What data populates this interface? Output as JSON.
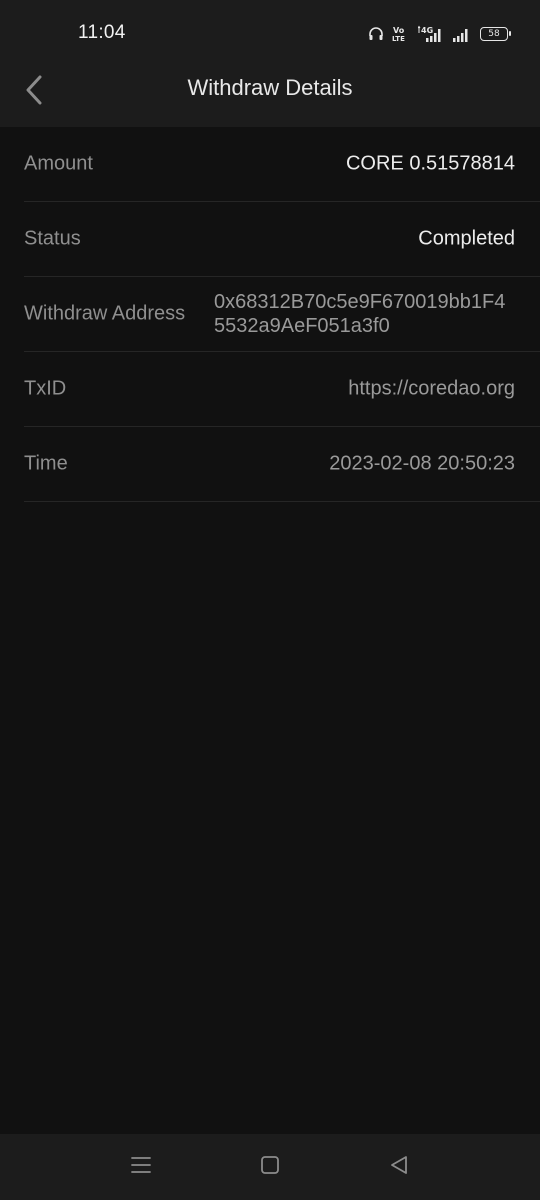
{
  "status_bar": {
    "time": "11:04",
    "network_label": "4G",
    "volte_label": "Vo LTE",
    "battery_level": "58",
    "icons": [
      "headphones-icon",
      "volte-icon",
      "signal-4g-icon",
      "signal-bars-icon",
      "battery-icon"
    ]
  },
  "header": {
    "title": "Withdraw Details",
    "back_icon": "chevron-left-icon"
  },
  "details": [
    {
      "label": "Amount",
      "value": "CORE 0.51578814"
    },
    {
      "label": "Status",
      "value": "Completed"
    },
    {
      "label": "Withdraw Address",
      "value": "0x68312B70c5e9F670019bb1F45532a9AeF051a3f0"
    },
    {
      "label": "TxID",
      "value": "https://coredao.org"
    },
    {
      "label": "Time",
      "value": "2023-02-08 20:50:23"
    }
  ],
  "nav_bar": {
    "icons": [
      "menu-icon",
      "home-square-icon",
      "back-triangle-icon"
    ]
  },
  "colors": {
    "background": "#111111",
    "bar_background": "#1c1c1c",
    "label_text": "#8f8f8f",
    "value_text_bright": "#ececec",
    "value_text_dim": "#9a9a9a",
    "divider": "#262626"
  }
}
